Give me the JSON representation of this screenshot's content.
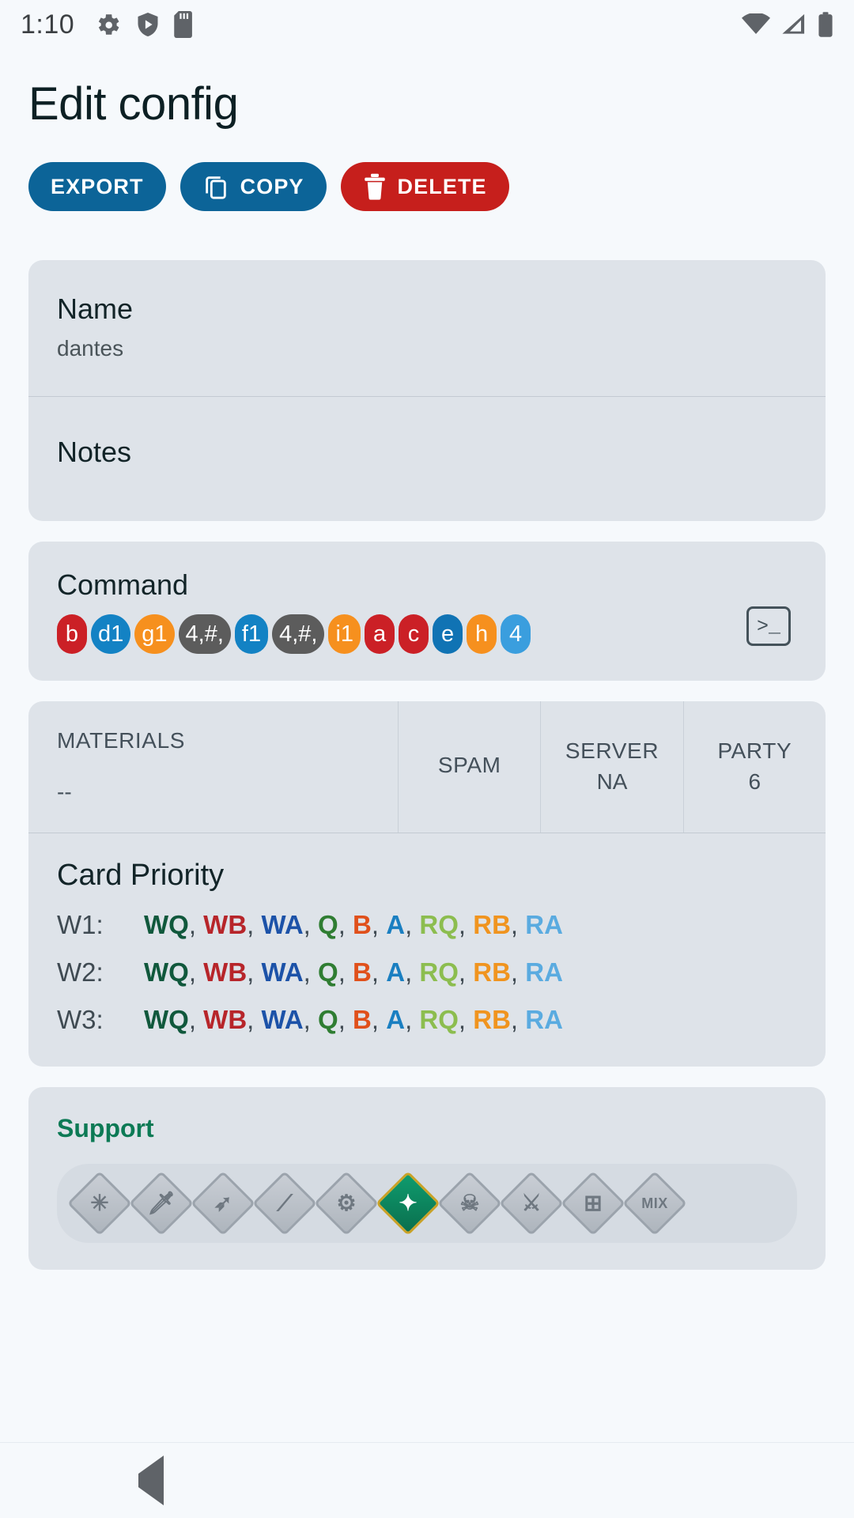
{
  "status_bar": {
    "time": "1:10",
    "left_icons": [
      "gear-icon",
      "shield-play-icon",
      "sd-card-icon"
    ],
    "right_icons": [
      "wifi-icon",
      "cellular-signal-icon",
      "battery-icon"
    ]
  },
  "header": {
    "title": "Edit config"
  },
  "actions": [
    {
      "label": "EXPORT",
      "icon": "",
      "color": "#0c6498",
      "style": "blue"
    },
    {
      "label": "COPY",
      "icon": "copy-icon",
      "color": "#0c6498",
      "style": "blue"
    },
    {
      "label": "DELETE",
      "icon": "trash-icon",
      "color": "#c61f1c",
      "style": "red"
    }
  ],
  "fields": {
    "name_label": "Name",
    "name_value": "dantes",
    "notes_label": "Notes",
    "notes_value": ""
  },
  "command": {
    "label": "Command",
    "terminal_icon": ">_",
    "pills": [
      {
        "text": "b",
        "color": "#cb2026"
      },
      {
        "text": "d1",
        "color": "#1382c4"
      },
      {
        "text": "g1",
        "color": "#f6901e"
      },
      {
        "text": "4,#,",
        "color": "#5c5c5c"
      },
      {
        "text": "f1",
        "color": "#1382c4"
      },
      {
        "text": "4,#,",
        "color": "#5c5c5c"
      },
      {
        "text": "i1",
        "color": "#f6901e"
      },
      {
        "text": "a",
        "color": "#cb2026"
      },
      {
        "text": "c",
        "color": "#cb2026"
      },
      {
        "text": "e",
        "color": "#1073b4"
      },
      {
        "text": "h",
        "color": "#f6901e"
      },
      {
        "text": "4",
        "color": "#3a9ede"
      }
    ]
  },
  "stats": [
    {
      "label": "MATERIALS",
      "value": "--"
    },
    {
      "label": "SPAM",
      "value": ""
    },
    {
      "label": "SERVER",
      "value": "NA"
    },
    {
      "label": "PARTY",
      "value": "6"
    }
  ],
  "card_priority": {
    "title": "Card Priority",
    "rows": [
      {
        "key": "W1:",
        "cards": [
          {
            "text": "WQ",
            "color": "#10583c"
          },
          {
            "text": "WB",
            "color": "#b7252a"
          },
          {
            "text": "WA",
            "color": "#1c52a8"
          },
          {
            "text": "Q",
            "color": "#2f7d32"
          },
          {
            "text": "B",
            "color": "#e0501b"
          },
          {
            "text": "A",
            "color": "#1a7fc1"
          },
          {
            "text": "RQ",
            "color": "#8cbd4f"
          },
          {
            "text": "RB",
            "color": "#f0941f"
          },
          {
            "text": "RA",
            "color": "#5aabe0"
          }
        ]
      },
      {
        "key": "W2:",
        "cards": [
          {
            "text": "WQ",
            "color": "#10583c"
          },
          {
            "text": "WB",
            "color": "#b7252a"
          },
          {
            "text": "WA",
            "color": "#1c52a8"
          },
          {
            "text": "Q",
            "color": "#2f7d32"
          },
          {
            "text": "B",
            "color": "#e0501b"
          },
          {
            "text": "A",
            "color": "#1a7fc1"
          },
          {
            "text": "RQ",
            "color": "#8cbd4f"
          },
          {
            "text": "RB",
            "color": "#f0941f"
          },
          {
            "text": "RA",
            "color": "#5aabe0"
          }
        ]
      },
      {
        "key": "W3:",
        "cards": [
          {
            "text": "WQ",
            "color": "#10583c"
          },
          {
            "text": "WB",
            "color": "#b7252a"
          },
          {
            "text": "WA",
            "color": "#1c52a8"
          },
          {
            "text": "Q",
            "color": "#2f7d32"
          },
          {
            "text": "B",
            "color": "#e0501b"
          },
          {
            "text": "A",
            "color": "#1a7fc1"
          },
          {
            "text": "RQ",
            "color": "#8cbd4f"
          },
          {
            "text": "RB",
            "color": "#f0941f"
          },
          {
            "text": "RA",
            "color": "#5aabe0"
          }
        ]
      }
    ]
  },
  "support": {
    "title": "Support",
    "title_color": "#0c7a55",
    "classes": [
      {
        "name": "all-class-icon",
        "glyph": "✳",
        "selected": false
      },
      {
        "name": "saber-class-icon",
        "glyph": "🗡",
        "selected": false
      },
      {
        "name": "archer-class-icon",
        "glyph": "➶",
        "selected": false
      },
      {
        "name": "lancer-class-icon",
        "glyph": "⟋",
        "selected": false
      },
      {
        "name": "rider-class-icon",
        "glyph": "⚙",
        "selected": false
      },
      {
        "name": "caster-class-icon",
        "glyph": "✦",
        "selected": true
      },
      {
        "name": "assassin-class-icon",
        "glyph": "☠",
        "selected": false
      },
      {
        "name": "berserker-class-icon",
        "glyph": "⚔",
        "selected": false
      },
      {
        "name": "extra-class-icon",
        "glyph": "⊞",
        "selected": false
      },
      {
        "name": "mix-class-icon",
        "glyph": "MIX",
        "selected": false
      }
    ]
  },
  "navbar": {
    "back": "back-button",
    "home": "home-button",
    "recents": "recents-button"
  }
}
